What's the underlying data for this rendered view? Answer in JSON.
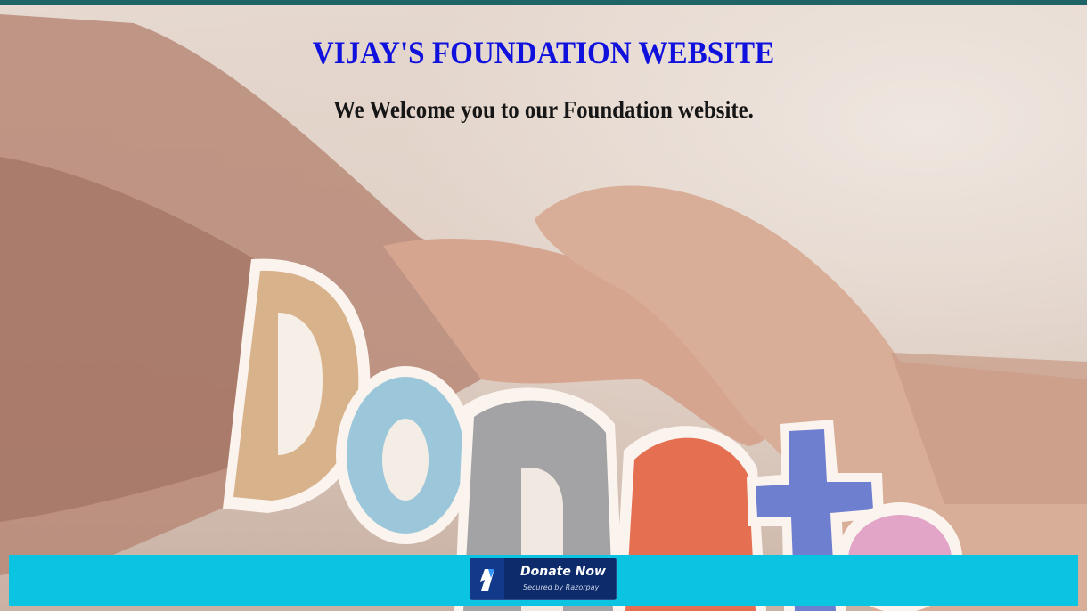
{
  "header": {
    "title": "VIJAY'S FOUNDATION WEBSITE",
    "welcome": "We Welcome you to our Foundation website."
  },
  "hero_image": {
    "description_word": "Donate",
    "letters": [
      "D",
      "o",
      "n",
      "a",
      "t",
      "e"
    ]
  },
  "donate_button": {
    "label": "Donate Now",
    "secured_text": "Secured by Razorpay"
  },
  "colors": {
    "title": "#1111dd",
    "donate_bar": "#0bc4e1",
    "donate_button": "#0d2a6b",
    "top_strip": "#1f6466"
  }
}
